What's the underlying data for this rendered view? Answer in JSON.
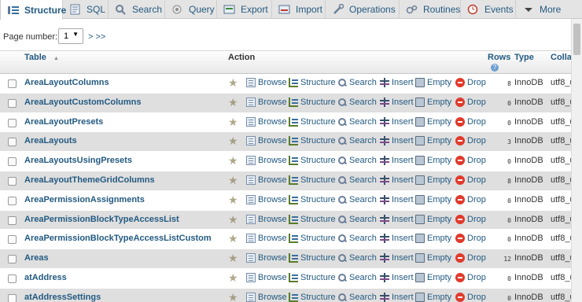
{
  "tabs": [
    {
      "label": "Structure",
      "icon": "structure-icon",
      "active": true
    },
    {
      "label": "SQL",
      "icon": "sql-icon"
    },
    {
      "label": "Search",
      "icon": "search-icon"
    },
    {
      "label": "Query",
      "icon": "query-icon"
    },
    {
      "label": "Export",
      "icon": "export-icon"
    },
    {
      "label": "Import",
      "icon": "import-icon"
    },
    {
      "label": "Operations",
      "icon": "wrench-icon"
    },
    {
      "label": "Routines",
      "icon": "routines-icon"
    },
    {
      "label": "Events",
      "icon": "clock-icon"
    },
    {
      "label": "More",
      "icon": "chevron-down-icon"
    }
  ],
  "pager": {
    "label": "Page number:",
    "selected": "1",
    "next": "> >>"
  },
  "columns": {
    "table": "Table",
    "sort_indicator": "▲",
    "action": "Action",
    "rows": "Rows",
    "type": "Type",
    "collation": "Colla"
  },
  "actions": {
    "browse": "Browse",
    "structure": "Structure",
    "search": "Search",
    "insert": "Insert",
    "empty": "Empty",
    "drop": "Drop"
  },
  "tables": [
    {
      "name": "AreaLayoutColumns",
      "rows": "8",
      "type": "InnoDB",
      "collation": "utf8_u"
    },
    {
      "name": "AreaLayoutCustomColumns",
      "rows": "0",
      "type": "InnoDB",
      "collation": "utf8_u"
    },
    {
      "name": "AreaLayoutPresets",
      "rows": "0",
      "type": "InnoDB",
      "collation": "utf8_u"
    },
    {
      "name": "AreaLayouts",
      "rows": "3",
      "type": "InnoDB",
      "collation": "utf8_u"
    },
    {
      "name": "AreaLayoutsUsingPresets",
      "rows": "0",
      "type": "InnoDB",
      "collation": "utf8_u"
    },
    {
      "name": "AreaLayoutThemeGridColumns",
      "rows": "8",
      "type": "InnoDB",
      "collation": "utf8_u"
    },
    {
      "name": "AreaPermissionAssignments",
      "rows": "0",
      "type": "InnoDB",
      "collation": "utf8_u"
    },
    {
      "name": "AreaPermissionBlockTypeAccessList",
      "rows": "0",
      "type": "InnoDB",
      "collation": "utf8_u"
    },
    {
      "name": "AreaPermissionBlockTypeAccessListCustom",
      "rows": "0",
      "type": "InnoDB",
      "collation": "utf8_u"
    },
    {
      "name": "Areas",
      "rows": "12",
      "type": "InnoDB",
      "collation": "utf8_u"
    },
    {
      "name": "atAddress",
      "rows": "0",
      "type": "InnoDB",
      "collation": "utf8_u"
    },
    {
      "name": "atAddressSettings",
      "rows": "0",
      "type": "InnoDB",
      "collation": "utf8_u"
    }
  ]
}
